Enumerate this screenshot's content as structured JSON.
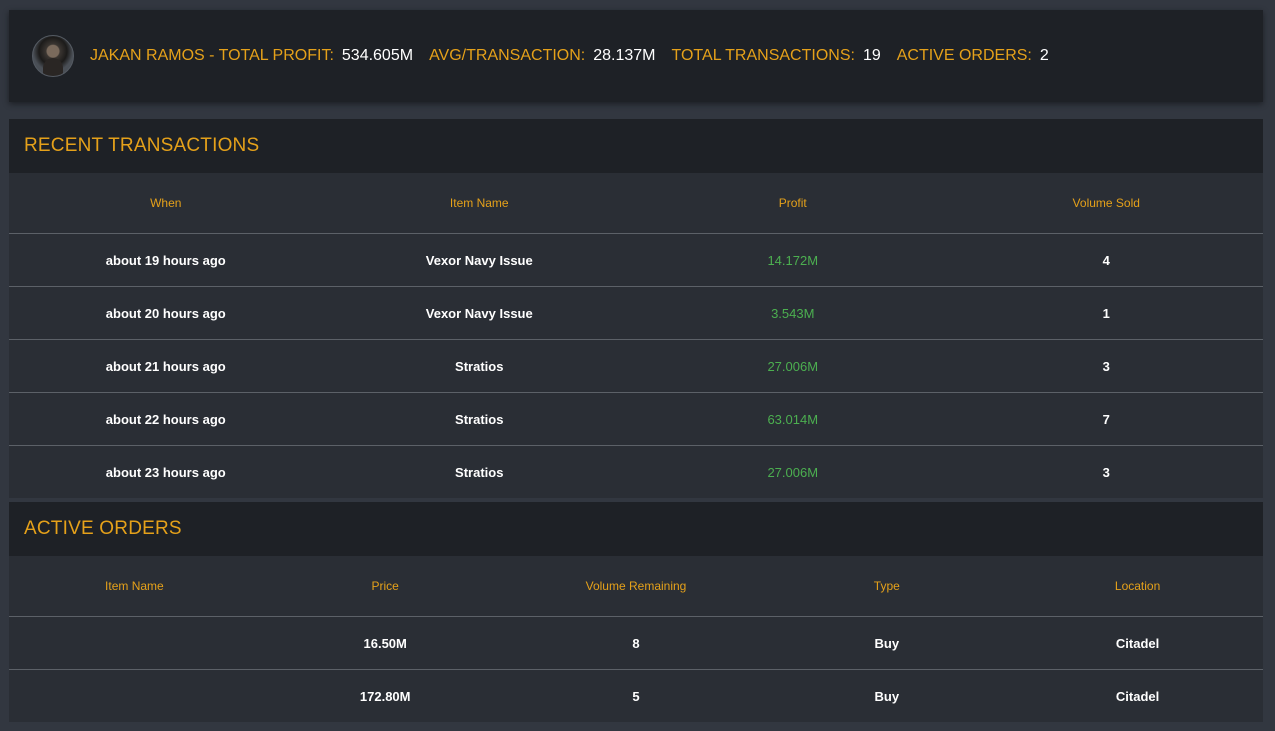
{
  "stats": {
    "total_profit_label": "JAKAN RAMOS - TOTAL PROFIT:",
    "total_profit_value": "534.605M",
    "avg_label": "AVG/TRANSACTION:",
    "avg_value": "28.137M",
    "total_tx_label": "TOTAL TRANSACTIONS:",
    "total_tx_value": "19",
    "active_orders_label": "ACTIVE ORDERS:",
    "active_orders_value": "2"
  },
  "recent": {
    "title": "RECENT TRANSACTIONS",
    "columns": [
      "When",
      "Item Name",
      "Profit",
      "Volume Sold"
    ],
    "rows": [
      {
        "when": "about 19 hours ago",
        "item": "Vexor Navy Issue",
        "profit": "14.172M",
        "volume": "4"
      },
      {
        "when": "about 20 hours ago",
        "item": "Vexor Navy Issue",
        "profit": "3.543M",
        "volume": "1"
      },
      {
        "when": "about 21 hours ago",
        "item": "Stratios",
        "profit": "27.006M",
        "volume": "3"
      },
      {
        "when": "about 22 hours ago",
        "item": "Stratios",
        "profit": "63.014M",
        "volume": "7"
      },
      {
        "when": "about 23 hours ago",
        "item": "Stratios",
        "profit": "27.006M",
        "volume": "3"
      }
    ]
  },
  "orders": {
    "title": "ACTIVE ORDERS",
    "columns": [
      "Item Name",
      "Price",
      "Volume Remaining",
      "Type",
      "Location"
    ],
    "rows": [
      {
        "item": "",
        "price": "16.50M",
        "volume": "8",
        "type": "Buy",
        "location": "Citadel"
      },
      {
        "item": "",
        "price": "172.80M",
        "volume": "5",
        "type": "Buy",
        "location": "Citadel"
      }
    ]
  },
  "colors": {
    "accent": "#e5a11a",
    "profit": "#4caf50",
    "background": "#323740",
    "header_bg": "#1e2126",
    "panel_bg": "#2a2e35"
  }
}
